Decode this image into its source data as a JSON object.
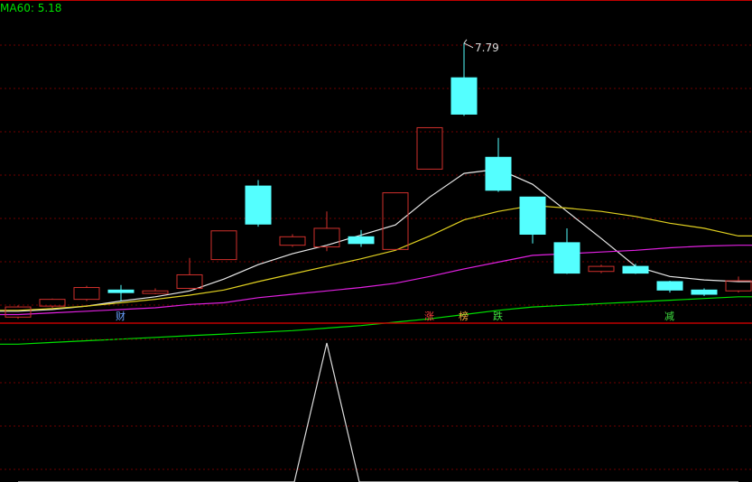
{
  "indicator": {
    "name": "MA60",
    "value": "5.18",
    "color": "#00e000"
  },
  "colors": {
    "up": "#d0302c",
    "down": "#54ffff",
    "ma_short": "#e8e8e8",
    "ma_mid": "#e0d020",
    "ma_long": "#e020e0",
    "ma60": "#00e000",
    "grid": "#700000",
    "separator": "#c00000",
    "lower_line": "#dcdcdc",
    "annotation": "#dcdcdc"
  },
  "events": [
    {
      "label": "财",
      "index": 3,
      "color": "#6aa0ff"
    },
    {
      "label": "涨",
      "index": 12,
      "color": "#ff4040"
    },
    {
      "label": "榜",
      "index": 13,
      "color": "#ffb040"
    },
    {
      "label": "跌",
      "index": 14,
      "color": "#40e040"
    },
    {
      "label": "减",
      "index": 19,
      "color": "#40e040"
    }
  ],
  "chart_data": [
    {
      "type": "candlestick",
      "y_range": [
        4.5,
        8.3
      ],
      "annotations": [
        {
          "text": "7.79",
          "index": 13,
          "value": 7.79
        }
      ],
      "candles": [
        {
          "o": 4.55,
          "c": 4.67,
          "h": 4.69,
          "l": 4.53
        },
        {
          "o": 4.68,
          "c": 4.76,
          "h": 4.77,
          "l": 4.66
        },
        {
          "o": 4.76,
          "c": 4.9,
          "h": 4.92,
          "l": 4.74
        },
        {
          "o": 4.87,
          "c": 4.84,
          "h": 4.93,
          "l": 4.74
        },
        {
          "o": 4.83,
          "c": 4.86,
          "h": 4.89,
          "l": 4.82
        },
        {
          "o": 4.89,
          "c": 5.05,
          "h": 5.25,
          "l": 4.88
        },
        {
          "o": 5.23,
          "c": 5.57,
          "h": 5.57,
          "l": 5.23
        },
        {
          "o": 6.1,
          "c": 5.65,
          "h": 6.17,
          "l": 5.62
        },
        {
          "o": 5.4,
          "c": 5.5,
          "h": 5.53,
          "l": 5.38
        },
        {
          "o": 5.38,
          "c": 5.6,
          "h": 5.8,
          "l": 5.33
        },
        {
          "o": 5.5,
          "c": 5.42,
          "h": 5.58,
          "l": 5.38
        },
        {
          "o": 5.35,
          "c": 6.02,
          "h": 6.02,
          "l": 5.35
        },
        {
          "o": 6.3,
          "c": 6.79,
          "h": 6.79,
          "l": 6.3
        },
        {
          "o": 7.38,
          "c": 6.95,
          "h": 7.79,
          "l": 6.93
        },
        {
          "o": 6.44,
          "c": 6.05,
          "h": 6.67,
          "l": 6.03
        },
        {
          "o": 5.97,
          "c": 5.53,
          "h": 5.97,
          "l": 5.42
        },
        {
          "o": 5.43,
          "c": 5.07,
          "h": 5.6,
          "l": 5.06
        },
        {
          "o": 5.09,
          "c": 5.15,
          "h": 5.17,
          "l": 5.07
        },
        {
          "o": 5.15,
          "c": 5.07,
          "h": 5.18,
          "l": 5.06
        },
        {
          "o": 4.97,
          "c": 4.87,
          "h": 4.98,
          "l": 4.84
        },
        {
          "o": 4.87,
          "c": 4.82,
          "h": 4.89,
          "l": 4.8
        },
        {
          "o": 4.86,
          "c": 4.98,
          "h": 5.03,
          "l": 4.84
        }
      ],
      "moving_averages": [
        {
          "key": "ma_short",
          "points": [
            [
              0,
              4.62
            ],
            [
              1,
              4.64
            ],
            [
              2,
              4.68
            ],
            [
              3,
              4.74
            ],
            [
              4,
              4.79
            ],
            [
              5,
              4.86
            ],
            [
              6,
              5.0
            ],
            [
              7,
              5.17
            ],
            [
              8,
              5.3
            ],
            [
              9,
              5.4
            ],
            [
              10,
              5.52
            ],
            [
              11,
              5.64
            ],
            [
              12,
              5.97
            ],
            [
              13,
              6.25
            ],
            [
              14,
              6.3
            ],
            [
              15,
              6.12
            ],
            [
              16,
              5.8
            ],
            [
              17,
              5.48
            ],
            [
              18,
              5.15
            ],
            [
              19,
              5.03
            ],
            [
              20,
              4.99
            ],
            [
              21,
              4.97
            ]
          ]
        },
        {
          "key": "ma_mid",
          "points": [
            [
              0,
              4.63
            ],
            [
              1,
              4.65
            ],
            [
              2,
              4.68
            ],
            [
              3,
              4.72
            ],
            [
              4,
              4.76
            ],
            [
              5,
              4.81
            ],
            [
              6,
              4.87
            ],
            [
              7,
              4.97
            ],
            [
              8,
              5.06
            ],
            [
              9,
              5.15
            ],
            [
              10,
              5.24
            ],
            [
              11,
              5.34
            ],
            [
              12,
              5.51
            ],
            [
              13,
              5.7
            ],
            [
              14,
              5.8
            ],
            [
              15,
              5.87
            ],
            [
              16,
              5.84
            ],
            [
              17,
              5.8
            ],
            [
              18,
              5.74
            ],
            [
              19,
              5.66
            ],
            [
              20,
              5.6
            ],
            [
              21,
              5.51
            ]
          ]
        },
        {
          "key": "ma_long",
          "points": [
            [
              0,
              4.58
            ],
            [
              1,
              4.6
            ],
            [
              2,
              4.62
            ],
            [
              3,
              4.64
            ],
            [
              4,
              4.66
            ],
            [
              5,
              4.7
            ],
            [
              6,
              4.72
            ],
            [
              7,
              4.78
            ],
            [
              8,
              4.82
            ],
            [
              9,
              4.86
            ],
            [
              10,
              4.9
            ],
            [
              11,
              4.95
            ],
            [
              12,
              5.03
            ],
            [
              13,
              5.12
            ],
            [
              14,
              5.2
            ],
            [
              15,
              5.28
            ],
            [
              16,
              5.3
            ],
            [
              17,
              5.32
            ],
            [
              18,
              5.34
            ],
            [
              19,
              5.37
            ],
            [
              20,
              5.39
            ],
            [
              21,
              5.4
            ]
          ]
        },
        {
          "key": "ma60",
          "points": [
            [
              0,
              4.23
            ],
            [
              1,
              4.25
            ],
            [
              2,
              4.27
            ],
            [
              3,
              4.29
            ],
            [
              4,
              4.31
            ],
            [
              5,
              4.33
            ],
            [
              6,
              4.35
            ],
            [
              7,
              4.37
            ],
            [
              8,
              4.39
            ],
            [
              9,
              4.42
            ],
            [
              10,
              4.45
            ],
            [
              11,
              4.49
            ],
            [
              12,
              4.53
            ],
            [
              13,
              4.58
            ],
            [
              14,
              4.63
            ],
            [
              15,
              4.67
            ],
            [
              16,
              4.69
            ],
            [
              17,
              4.71
            ],
            [
              18,
              4.73
            ],
            [
              19,
              4.75
            ],
            [
              20,
              4.77
            ],
            [
              21,
              4.79
            ]
          ]
        }
      ]
    },
    {
      "type": "line",
      "x": [
        0,
        8,
        9,
        10,
        21
      ],
      "y": [
        0,
        0,
        1,
        0,
        0
      ],
      "y_range": [
        0,
        1
      ]
    }
  ]
}
